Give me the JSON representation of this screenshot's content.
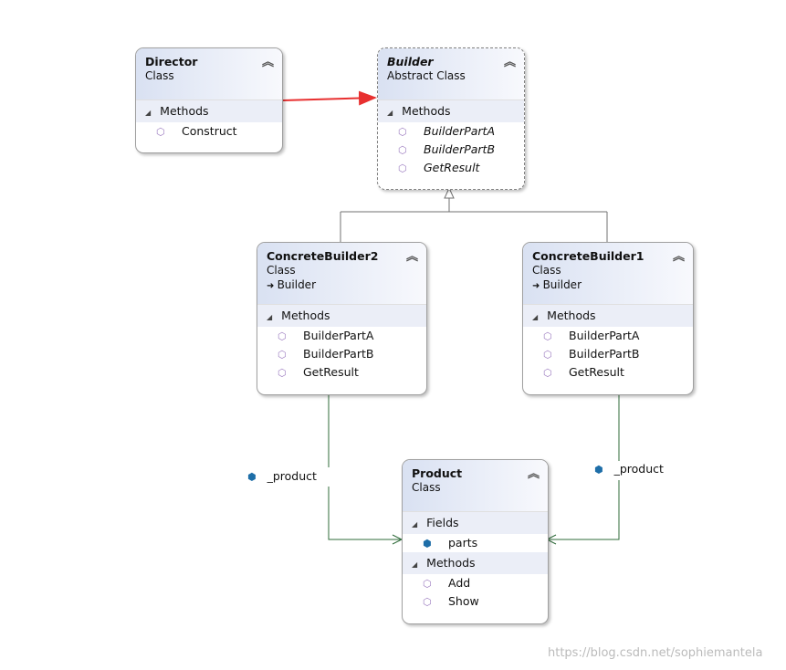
{
  "classes": {
    "director": {
      "name": "Director",
      "kind": "Class",
      "sections": [
        {
          "label": "Methods",
          "items": [
            "Construct"
          ]
        }
      ]
    },
    "builder": {
      "name": "Builder",
      "kind": "Abstract Class",
      "sections": [
        {
          "label": "Methods",
          "items": [
            "BuilderPartA",
            "BuilderPartB",
            "GetResult"
          ]
        }
      ]
    },
    "concrete2": {
      "name": "ConcreteBuilder2",
      "kind": "Class",
      "inherits": "Builder",
      "sections": [
        {
          "label": "Methods",
          "items": [
            "BuilderPartA",
            "BuilderPartB",
            "GetResult"
          ]
        }
      ]
    },
    "concrete1": {
      "name": "ConcreteBuilder1",
      "kind": "Class",
      "inherits": "Builder",
      "sections": [
        {
          "label": "Methods",
          "items": [
            "BuilderPartA",
            "BuilderPartB",
            "GetResult"
          ]
        }
      ]
    },
    "product": {
      "name": "Product",
      "kind": "Class",
      "sections": [
        {
          "label": "Fields",
          "items": [
            "parts"
          ],
          "field": true
        },
        {
          "label": "Methods",
          "items": [
            "Add",
            "Show"
          ]
        }
      ]
    }
  },
  "associations": {
    "left_label": "_product",
    "right_label": "_product"
  },
  "colors": {
    "director_arrow": "#e83030",
    "inheritance": "#707070",
    "association": "#2f6b3a"
  },
  "watermark": "https://blog.csdn.net/sophiemantela"
}
